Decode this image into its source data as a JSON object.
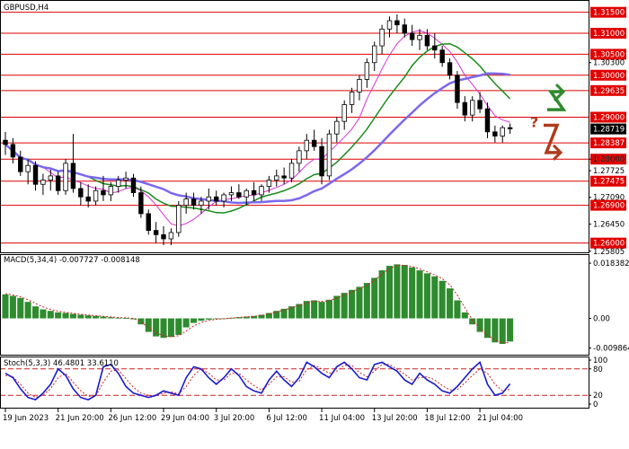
{
  "chart_data": {
    "symbol_label": "GBPUSD,H4",
    "type": "candlestick",
    "main_panel": {
      "ylim": [
        1.258,
        1.3175
      ],
      "price_levels": [
        "1.31500",
        "1.31000",
        "1.30500",
        "1.30000",
        "1.29635",
        "1.29000",
        "1.28387",
        "1.28000",
        "1.27475",
        "1.26900",
        "1.26000"
      ],
      "price_ticks": [
        "1.30300",
        "1.28000",
        "1.27725",
        "1.27090",
        "1.26450",
        "1.25805"
      ],
      "current_price": "1.28719",
      "forecast_mark": "?",
      "candles": [
        [
          1.2845,
          1.2865,
          1.281,
          1.2835
        ],
        [
          1.2835,
          1.285,
          1.279,
          1.2805
        ],
        [
          1.2805,
          1.282,
          1.276,
          1.277
        ],
        [
          1.277,
          1.28,
          1.274,
          1.2785
        ],
        [
          1.2785,
          1.2795,
          1.2725,
          1.274
        ],
        [
          1.274,
          1.2765,
          1.2715,
          1.275
        ],
        [
          1.275,
          1.2775,
          1.2725,
          1.276
        ],
        [
          1.276,
          1.277,
          1.2715,
          1.2725
        ],
        [
          1.2725,
          1.28,
          1.2715,
          1.279
        ],
        [
          1.279,
          1.286,
          1.272,
          1.273
        ],
        [
          1.273,
          1.2745,
          1.269,
          1.271
        ],
        [
          1.271,
          1.274,
          1.2685,
          1.27
        ],
        [
          1.27,
          1.2735,
          1.269,
          1.2725
        ],
        [
          1.2725,
          1.276,
          1.27,
          1.2715
        ],
        [
          1.2715,
          1.2745,
          1.27,
          1.2735
        ],
        [
          1.2735,
          1.276,
          1.272,
          1.275
        ],
        [
          1.275,
          1.277,
          1.273,
          1.2755
        ],
        [
          1.2755,
          1.2765,
          1.271,
          1.272
        ],
        [
          1.272,
          1.2735,
          1.266,
          1.267
        ],
        [
          1.267,
          1.268,
          1.262,
          1.263
        ],
        [
          1.263,
          1.265,
          1.26,
          1.262
        ],
        [
          1.262,
          1.264,
          1.2595,
          1.261
        ],
        [
          1.261,
          1.2635,
          1.2595,
          1.2625
        ],
        [
          1.2625,
          1.27,
          1.2615,
          1.269
        ],
        [
          1.269,
          1.272,
          1.267,
          1.2705
        ],
        [
          1.2705,
          1.272,
          1.268,
          1.269
        ],
        [
          1.269,
          1.271,
          1.267,
          1.27
        ],
        [
          1.27,
          1.273,
          1.268,
          1.271
        ],
        [
          1.271,
          1.2725,
          1.269,
          1.27
        ],
        [
          1.27,
          1.272,
          1.2685,
          1.2715
        ],
        [
          1.2715,
          1.2735,
          1.27,
          1.272
        ],
        [
          1.272,
          1.274,
          1.2705,
          1.271
        ],
        [
          1.271,
          1.273,
          1.269,
          1.2725
        ],
        [
          1.2725,
          1.2745,
          1.27,
          1.2715
        ],
        [
          1.2715,
          1.274,
          1.27,
          1.2735
        ],
        [
          1.2735,
          1.276,
          1.272,
          1.275
        ],
        [
          1.275,
          1.2775,
          1.2735,
          1.276
        ],
        [
          1.276,
          1.278,
          1.274,
          1.2755
        ],
        [
          1.2755,
          1.28,
          1.2745,
          1.279
        ],
        [
          1.279,
          1.283,
          1.277,
          1.282
        ],
        [
          1.282,
          1.286,
          1.28,
          1.2845
        ],
        [
          1.2845,
          1.287,
          1.282,
          1.283
        ],
        [
          1.283,
          1.285,
          1.274,
          1.276
        ],
        [
          1.276,
          1.287,
          1.275,
          1.286
        ],
        [
          1.286,
          1.29,
          1.284,
          1.289
        ],
        [
          1.289,
          1.294,
          1.287,
          1.293
        ],
        [
          1.293,
          1.297,
          1.291,
          1.296
        ],
        [
          1.296,
          1.3,
          1.294,
          1.299
        ],
        [
          1.299,
          1.304,
          1.297,
          1.303
        ],
        [
          1.303,
          1.308,
          1.301,
          1.307
        ],
        [
          1.307,
          1.312,
          1.305,
          1.311
        ],
        [
          1.311,
          1.314,
          1.309,
          1.313
        ],
        [
          1.313,
          1.3145,
          1.31,
          1.312
        ],
        [
          1.312,
          1.3135,
          1.309,
          1.31
        ],
        [
          1.31,
          1.312,
          1.307,
          1.3085
        ],
        [
          1.3085,
          1.311,
          1.306,
          1.3095
        ],
        [
          1.3095,
          1.311,
          1.306,
          1.307
        ],
        [
          1.307,
          1.31,
          1.304,
          1.306
        ],
        [
          1.306,
          1.307,
          1.302,
          1.303
        ],
        [
          1.303,
          1.304,
          1.299,
          1.3
        ],
        [
          1.3,
          1.301,
          1.292,
          1.2935
        ],
        [
          1.2935,
          1.295,
          1.289,
          1.2905
        ],
        [
          1.2905,
          1.295,
          1.289,
          1.294
        ],
        [
          1.294,
          1.296,
          1.291,
          1.292
        ],
        [
          1.292,
          1.2935,
          1.285,
          1.2865
        ],
        [
          1.2865,
          1.288,
          1.284,
          1.2855
        ],
        [
          1.2855,
          1.288,
          1.284,
          1.2875
        ],
        [
          1.2875,
          1.2885,
          1.286,
          1.2872
        ]
      ]
    },
    "macd": {
      "label": "MACD(5,34,4) -0.007727 -0.008148",
      "ticks": [
        "0.018382",
        "0.00",
        "-0.009864"
      ],
      "ylim": [
        -0.0115,
        0.0205
      ],
      "histogram": [
        0.008,
        0.0075,
        0.0068,
        0.0055,
        0.004,
        0.003,
        0.0025,
        0.002,
        0.0018,
        0.0015,
        0.0012,
        0.001,
        0.0008,
        0.0006,
        0.0004,
        0.0002,
        0.0001,
        -0.0003,
        -0.002,
        -0.0045,
        -0.006,
        -0.0065,
        -0.0062,
        -0.0055,
        -0.003,
        -0.0015,
        -0.0008,
        -0.0004,
        -0.0002,
        0.0,
        0.0002,
        0.0004,
        0.0006,
        0.0008,
        0.0012,
        0.0018,
        0.0025,
        0.0032,
        0.004,
        0.0048,
        0.0058,
        0.006,
        0.0055,
        0.0062,
        0.0075,
        0.0085,
        0.0095,
        0.0105,
        0.0118,
        0.0135,
        0.016,
        0.0175,
        0.018,
        0.0178,
        0.017,
        0.016,
        0.015,
        0.014,
        0.0125,
        0.01,
        0.006,
        0.002,
        -0.002,
        -0.0045,
        -0.0065,
        -0.008,
        -0.0085,
        -0.0077
      ],
      "signal": [
        0.0082,
        0.0078,
        0.0072,
        0.0062,
        0.005,
        0.0038,
        0.003,
        0.0024,
        0.002,
        0.0017,
        0.0014,
        0.0011,
        0.0009,
        0.0007,
        0.0005,
        0.0003,
        0.0002,
        0.0,
        -0.0012,
        -0.003,
        -0.0048,
        -0.0058,
        -0.0061,
        -0.0058,
        -0.0042,
        -0.0025,
        -0.0014,
        -0.0007,
        -0.0003,
        -0.0001,
        0.0001,
        0.0003,
        0.0005,
        0.0007,
        0.001,
        0.0015,
        0.0021,
        0.0028,
        0.0035,
        0.0043,
        0.0052,
        0.0057,
        0.0056,
        0.0059,
        0.0068,
        0.0078,
        0.0088,
        0.0099,
        0.011,
        0.0126,
        0.0148,
        0.0166,
        0.0176,
        0.0177,
        0.0173,
        0.0165,
        0.0155,
        0.0145,
        0.0132,
        0.0112,
        0.0078,
        0.0036,
        -0.0005,
        -0.0034,
        -0.0056,
        -0.0072,
        -0.0081,
        -0.0081
      ]
    },
    "stochastic": {
      "label": "Stoch(5,3,3) 46.4801 33.6110",
      "ticks": [
        "100",
        "80",
        "20",
        "0"
      ],
      "ylim": [
        0,
        100
      ],
      "levels": [
        80,
        20
      ],
      "main": [
        70,
        60,
        35,
        15,
        10,
        25,
        45,
        80,
        65,
        35,
        15,
        10,
        20,
        85,
        90,
        70,
        40,
        25,
        20,
        15,
        20,
        30,
        25,
        20,
        60,
        85,
        80,
        60,
        45,
        60,
        80,
        65,
        40,
        30,
        25,
        55,
        75,
        55,
        40,
        60,
        95,
        85,
        70,
        60,
        85,
        95,
        80,
        60,
        55,
        90,
        95,
        85,
        75,
        55,
        45,
        70,
        55,
        45,
        30,
        25,
        40,
        60,
        80,
        95,
        45,
        20,
        25,
        46
      ],
      "signal": [
        65,
        62,
        45,
        25,
        15,
        20,
        35,
        60,
        70,
        50,
        30,
        18,
        18,
        50,
        75,
        78,
        58,
        38,
        25,
        20,
        18,
        25,
        28,
        23,
        40,
        65,
        80,
        70,
        55,
        55,
        70,
        70,
        55,
        42,
        32,
        45,
        62,
        62,
        50,
        52,
        78,
        88,
        80,
        70,
        75,
        88,
        88,
        72,
        62,
        75,
        90,
        90,
        80,
        68,
        55,
        60,
        62,
        55,
        42,
        32,
        33,
        48,
        65,
        80,
        70,
        45,
        30,
        33.6
      ]
    },
    "x_tick_labels": [
      "19 Jun 2023",
      "21 Jun 20:00",
      "26 Jun 12:00",
      "29 Jun 04:00",
      "3 Jul 20:00",
      "6 Jul 12:00",
      "11 Jul 04:00",
      "13 Jul 20:00",
      "18 Jul 12:00",
      "21 Jul 04:00"
    ],
    "colors": {
      "level_line": "#dd0000",
      "price_badge": "#e00000",
      "current_badge": "#000000",
      "bull_candle": "#ffffff",
      "bear_candle": "#000000",
      "ma_fast": "#d633d6",
      "ma_mid": "#1a8c1a",
      "ma_slow": "#7b68ee",
      "macd_bar": "#2e8b2e",
      "macd_signal": "#cc2222",
      "stoch_main": "#1a1acc",
      "stoch_signal": "#cc2222",
      "arrow_up": "#2e8b2e",
      "arrow_down": "#b03a1a"
    }
  }
}
